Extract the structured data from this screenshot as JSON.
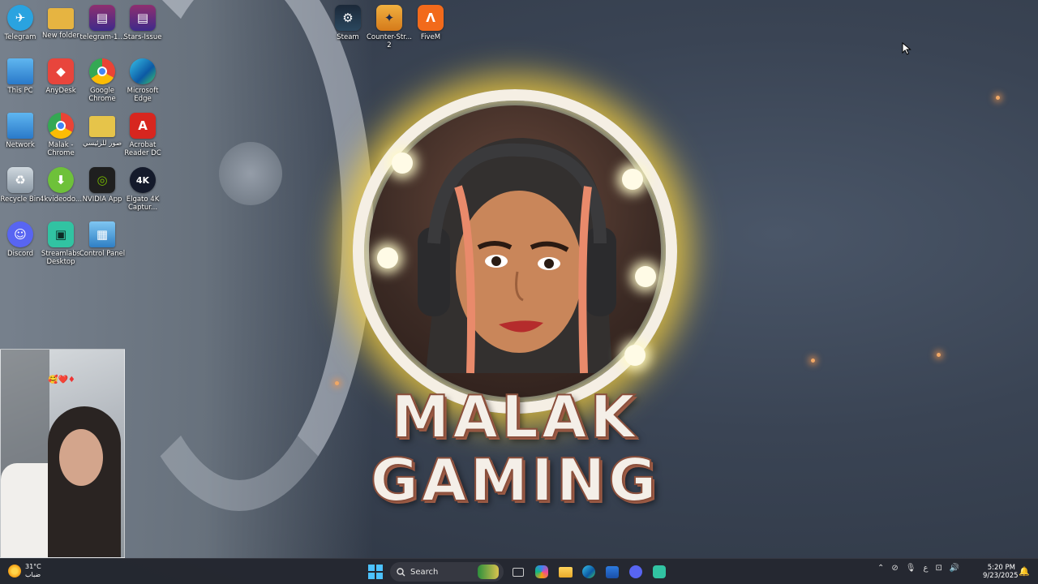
{
  "desktop": {
    "icons": [
      {
        "label": "Telegram",
        "color": "#2aa3e0",
        "glyph": "✈"
      },
      {
        "label": "New folder",
        "color": "#e6b441",
        "glyph": "▬"
      },
      {
        "label": "telegram-1...",
        "color": "#8e2f6f",
        "glyph": "▤"
      },
      {
        "label": "Stars-Issue",
        "color": "#8e2f6f",
        "glyph": "▤"
      },
      {
        "label": "This PC",
        "color": "#3a90d6",
        "glyph": "▭"
      },
      {
        "label": "AnyDesk",
        "color": "#e8453c",
        "glyph": "◆"
      },
      {
        "label": "Google Chrome",
        "color": "#e6e6e6",
        "glyph": "◉"
      },
      {
        "label": "Microsoft Edge",
        "color": "#1e9bd7",
        "glyph": "◐"
      },
      {
        "label": "Network",
        "color": "#3a90d6",
        "glyph": "▭"
      },
      {
        "label": "Malak - Chrome",
        "color": "#e6e6e6",
        "glyph": "◉"
      },
      {
        "label": "صور للرئيسي",
        "color": "#e6c44a",
        "glyph": "▬"
      },
      {
        "label": "Acrobat Reader DC",
        "color": "#d7261f",
        "glyph": "A"
      },
      {
        "label": "Recycle Bin",
        "color": "#6f7d8a",
        "glyph": "♻"
      },
      {
        "label": "4kvideodo...",
        "color": "#6ec13a",
        "glyph": "⬇"
      },
      {
        "label": "NVIDIA App",
        "color": "#2d2d2d",
        "glyph": "◎"
      },
      {
        "label": "Elgato 4K Captur...",
        "color": "#1b1b1b",
        "glyph": "4K"
      },
      {
        "label": "Discord",
        "color": "#5865f2",
        "glyph": "☺"
      },
      {
        "label": "Streamlabs Desktop",
        "color": "#31c3a2",
        "glyph": "▣"
      },
      {
        "label": "Control Panel",
        "color": "#3d8fd1",
        "glyph": "▦"
      },
      {
        "label": "Steam",
        "color": "#1b2838",
        "glyph": "⚙"
      },
      {
        "label": "Counter-Str... 2",
        "color": "#e59a2b",
        "glyph": "✦"
      },
      {
        "label": "FiveM",
        "color": "#f26a1b",
        "glyph": "Λ"
      }
    ]
  },
  "wallpaper": {
    "brand_line1": "MALAK",
    "brand_line2": "GAMING"
  },
  "webcam": {
    "stickers": "🥰❤️♦"
  },
  "taskbar": {
    "weather_temp": "31°C",
    "weather_desc": "ضباب",
    "search_label": "Search",
    "language": "ع",
    "time": "5:20 PM",
    "date": "9/23/2025"
  }
}
